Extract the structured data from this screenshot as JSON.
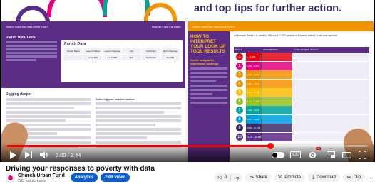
{
  "video": {
    "headline": "and top tips for further action.",
    "left_page": {
      "strip_left": "Where does the data come from?",
      "strip_right": "How do I use the data?",
      "heading": "Parish Data Table",
      "card_title": "Parish Data",
      "card_cols": [
        "Parish Name",
        "Level in Nation",
        "Level in Diocese",
        "Cls",
        "Cls Perish",
        "Ref in Diocese"
      ],
      "card_vals": [
        "",
        "Level ###",
        "Level ###",
        "Ref",
        "Ref Perish",
        "Ref ###"
      ],
      "subheading": "Digging deeper",
      "col_b_title": "Gathering your own information"
    },
    "right_page": {
      "strip": "Where does the data come from?",
      "heading": "HOW TO INTERPRET YOUR LOOK UP TOOL RESULTS",
      "subheading": "Decile and parish deprivation rankings",
      "intro": "An example: Parish X is ranked 2,000 out of 12,382 parishes in England, where 1 is the most deprived.",
      "table_headers": [
        "DECILE",
        "DESCRIPTION",
        "LOOK UP TOOL RESULT"
      ],
      "rows": [
        {
          "n": "1",
          "rank": "1 – 1,238",
          "color": "#e30613"
        },
        {
          "n": "2",
          "rank": "1,239 – 2,476",
          "color": "#e6007e"
        },
        {
          "n": "3",
          "rank": "2,477 – 3,714",
          "color": "#f39200"
        },
        {
          "n": "4",
          "rank": "3,715 – 4,952",
          "color": "#f39200"
        },
        {
          "n": "5",
          "rank": "4,953 – 6,190",
          "color": "#fbbd00"
        },
        {
          "n": "6",
          "rank": "6,191 – 7,428",
          "color": "#95c11f"
        },
        {
          "n": "7",
          "rank": "7,429 – 8,666",
          "color": "#00a19a"
        },
        {
          "n": "8",
          "rank": "8,667 – 9,904",
          "color": "#009fe3"
        },
        {
          "n": "9",
          "rank": "9,905 – 11,143",
          "color": "#3d2b6b"
        },
        {
          "n": "10",
          "rank": "11,144 – 12,382",
          "color": "#5b2c86"
        }
      ]
    }
  },
  "player": {
    "time": "2:00 / 2:44",
    "progress": 0.73,
    "cc_label": "CC",
    "hd_label": "HD",
    "icons": {
      "play": "play-icon",
      "next": "next-icon",
      "volume": "volume-icon",
      "autoplay": "autoplay-toggle",
      "settings": "gear-icon",
      "miniplayer": "miniplayer-icon",
      "theater": "theater-icon",
      "fullscreen": "fullscreen-icon"
    }
  },
  "page": {
    "title": "Driving your responses to poverty with data",
    "channel_name": "Church Urban Fund",
    "subscribers": "283 subscribers",
    "analytics_label": "Analytics",
    "edit_label": "Edit video",
    "like_count": "0",
    "actions": [
      {
        "label": "Share",
        "icon": "share-icon"
      },
      {
        "label": "Promote",
        "icon": "promote-icon"
      },
      {
        "label": "Download",
        "icon": "download-icon"
      },
      {
        "label": "Clip",
        "icon": "clip-icon"
      }
    ],
    "more": "more-icon"
  }
}
